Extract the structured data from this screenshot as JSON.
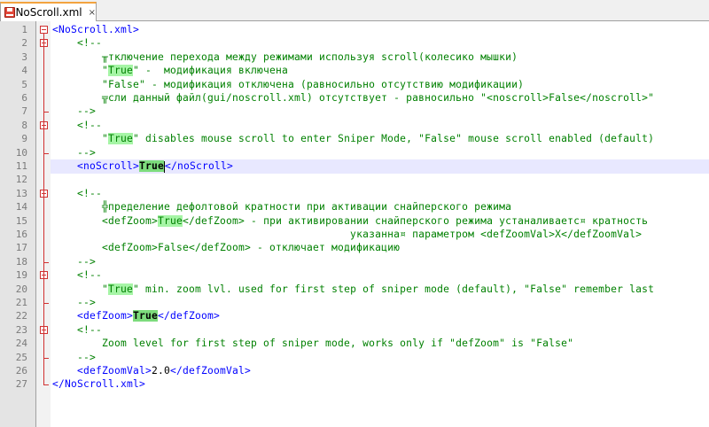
{
  "tab": {
    "label": "NoScroll.xml",
    "close": "×"
  },
  "colors": {
    "tag": "#0000ff",
    "comment": "#008000",
    "text": "#000000",
    "highlight": "#a6f5a6",
    "current_line": "#e8e8ff"
  },
  "line_numbers": [
    "1",
    "2",
    "3",
    "4",
    "5",
    "6",
    "7",
    "8",
    "9",
    "10",
    "11",
    "12",
    "13",
    "14",
    "15",
    "16",
    "17",
    "18",
    "19",
    "20",
    "21",
    "22",
    "23",
    "24",
    "25",
    "26",
    "27"
  ],
  "lines": [
    [
      {
        "t": "<NoScroll.xml>",
        "c": "tag"
      }
    ],
    [
      {
        "t": "    <!--",
        "c": "cmt"
      }
    ],
    [
      {
        "t": "        ╥тключение перехода между режимами используя scroll(колесико мышки)",
        "c": "cmt"
      }
    ],
    [
      {
        "t": "        \"",
        "c": "cmt"
      },
      {
        "t": "True",
        "c": "cmt hl"
      },
      {
        "t": "\" -  модификация включена",
        "c": "cmt"
      }
    ],
    [
      {
        "t": "        \"False\" - модификация отключена (равносильно отсутствию модификации)",
        "c": "cmt"
      }
    ],
    [
      {
        "t": "        ╦сли данный файл(gui/noscroll.xml) отсутствует - равносильно \"<noscroll>False</noscroll>\"",
        "c": "cmt"
      }
    ],
    [
      {
        "t": "    -->",
        "c": "cmt"
      }
    ],
    [
      {
        "t": "    <!--",
        "c": "cmt"
      }
    ],
    [
      {
        "t": "        \"",
        "c": "cmt"
      },
      {
        "t": "True",
        "c": "cmt hl"
      },
      {
        "t": "\" disables mouse scroll to enter Sniper Mode, \"False\" mouse scroll enabled (default)",
        "c": "cmt"
      }
    ],
    [
      {
        "t": "    -->",
        "c": "cmt"
      }
    ],
    [
      {
        "t": "    <noScroll>",
        "c": "tag"
      },
      {
        "t": "True",
        "c": "txt hls"
      },
      {
        "t": "CARET",
        "c": "caret"
      },
      {
        "t": "</noScroll>",
        "c": "tag"
      }
    ],
    [
      {
        "t": "",
        "c": "txt"
      }
    ],
    [
      {
        "t": "    <!--",
        "c": "cmt"
      }
    ],
    [
      {
        "t": "        ╬пределение дефолтовой кратности при активации снайперского режима",
        "c": "cmt"
      }
    ],
    [
      {
        "t": "        <defZoom>",
        "c": "cmt"
      },
      {
        "t": "True",
        "c": "cmt hl"
      },
      {
        "t": "</defZoom> - при активировании снайперского режима устаналиваетс¤ кратность",
        "c": "cmt"
      }
    ],
    [
      {
        "t": "                                                указанна¤ параметром <defZoomVal>X</defZoomVal>",
        "c": "cmt"
      }
    ],
    [
      {
        "t": "        <defZoom>False</defZoom> - отключает модификацию",
        "c": "cmt"
      }
    ],
    [
      {
        "t": "    -->",
        "c": "cmt"
      }
    ],
    [
      {
        "t": "    <!--",
        "c": "cmt"
      }
    ],
    [
      {
        "t": "        \"",
        "c": "cmt"
      },
      {
        "t": "True",
        "c": "cmt hl"
      },
      {
        "t": "\" min. zoom lvl. used for first step of sniper mode (default), \"False\" remember last",
        "c": "cmt"
      }
    ],
    [
      {
        "t": "    -->",
        "c": "cmt"
      }
    ],
    [
      {
        "t": "    <defZoom>",
        "c": "tag"
      },
      {
        "t": "True",
        "c": "txt hls"
      },
      {
        "t": "</defZoom>",
        "c": "tag"
      }
    ],
    [
      {
        "t": "    <!--",
        "c": "cmt"
      }
    ],
    [
      {
        "t": "        Zoom level for first step of sniper mode, works only if \"defZoom\" is \"False\"",
        "c": "cmt"
      }
    ],
    [
      {
        "t": "    -->",
        "c": "cmt"
      }
    ],
    [
      {
        "t": "    <defZoomVal>",
        "c": "tag"
      },
      {
        "t": "2.0",
        "c": "txt"
      },
      {
        "t": "</defZoomVal>",
        "c": "tag"
      }
    ],
    [
      {
        "t": "</NoScroll.xml>",
        "c": "tag"
      }
    ]
  ]
}
